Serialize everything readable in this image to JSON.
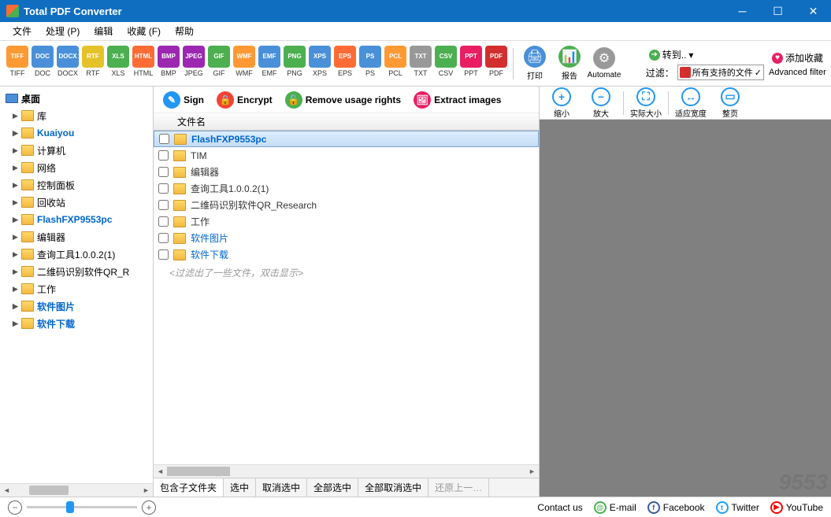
{
  "window": {
    "title": "Total PDF Converter"
  },
  "menu": [
    "文件",
    "处理 (P)",
    "编辑",
    "收藏 (F)",
    "帮助"
  ],
  "formats": [
    {
      "label": "TIFF",
      "color": "#ff9933"
    },
    {
      "label": "DOC",
      "color": "#4a90d9"
    },
    {
      "label": "DOCX",
      "color": "#4a90d9"
    },
    {
      "label": "RTF",
      "color": "#e6c229"
    },
    {
      "label": "XLS",
      "color": "#4caf50"
    },
    {
      "label": "HTML",
      "color": "#ff6b35"
    },
    {
      "label": "BMP",
      "color": "#9c27b0"
    },
    {
      "label": "JPEG",
      "color": "#9c27b0"
    },
    {
      "label": "GIF",
      "color": "#4caf50"
    },
    {
      "label": "WMF",
      "color": "#ff9933"
    },
    {
      "label": "EMF",
      "color": "#4a90d9"
    },
    {
      "label": "PNG",
      "color": "#4caf50"
    },
    {
      "label": "XPS",
      "color": "#4a90d9"
    },
    {
      "label": "EPS",
      "color": "#ff6b35"
    },
    {
      "label": "PS",
      "color": "#4a90d9"
    },
    {
      "label": "PCL",
      "color": "#ff9933"
    },
    {
      "label": "TXT",
      "color": "#999"
    },
    {
      "label": "CSV",
      "color": "#4caf50"
    },
    {
      "label": "PPT",
      "color": "#e91e63"
    },
    {
      "label": "PDF",
      "color": "#d32f2f"
    }
  ],
  "toolbar_big": [
    {
      "label": "打印",
      "icon": "🖨",
      "bg": "#4a90d9"
    },
    {
      "label": "报告",
      "icon": "📊",
      "bg": "#4caf50"
    },
    {
      "label": "Automate",
      "icon": "⚙",
      "bg": "#999"
    }
  ],
  "toolbar_links": {
    "goto": "转到..",
    "fav": "添加收藏"
  },
  "filter": {
    "label": "过滤：",
    "selected": "所有支持的文件",
    "adv": "Advanced filter"
  },
  "tree": {
    "root": "桌面",
    "items": [
      {
        "label": "库",
        "icon": "lib"
      },
      {
        "label": "Kuaiyou",
        "icon": "folder",
        "sel": true
      },
      {
        "label": "计算机",
        "icon": "pc"
      },
      {
        "label": "网络",
        "icon": "net"
      },
      {
        "label": "控制面板",
        "icon": "ctrl"
      },
      {
        "label": "回收站",
        "icon": "bin"
      },
      {
        "label": "FlashFXP9553pc",
        "icon": "folder",
        "sel": true
      },
      {
        "label": "编辑器",
        "icon": "folder"
      },
      {
        "label": "查询工具1.0.0.2(1)",
        "icon": "folder"
      },
      {
        "label": "二维码识别软件QR_R",
        "icon": "folder"
      },
      {
        "label": "工作",
        "icon": "folder"
      },
      {
        "label": "软件图片",
        "icon": "folder",
        "sel": true
      },
      {
        "label": "软件下载",
        "icon": "folder",
        "sel": true
      }
    ]
  },
  "actions": [
    {
      "label": "Sign",
      "bg": "#2196f3",
      "icon": "✎"
    },
    {
      "label": "Encrypt",
      "bg": "#f44336",
      "icon": "🔒"
    },
    {
      "label": "Remove usage rights",
      "bg": "#4caf50",
      "icon": "🔓"
    },
    {
      "label": "Extract images",
      "bg": "#e91e63",
      "icon": "🖼"
    }
  ],
  "file_header": "文件名",
  "files": [
    {
      "name": "FlashFXP9553pc",
      "sel": true
    },
    {
      "name": "TIM"
    },
    {
      "name": "编辑器"
    },
    {
      "name": "查询工具1.0.0.2(1)"
    },
    {
      "name": "二维码识别软件QR_Research"
    },
    {
      "name": "工作"
    },
    {
      "name": "软件图片",
      "link": true
    },
    {
      "name": "软件下载",
      "link": true
    }
  ],
  "filter_msg": "<过滤出了一些文件，双击显示>",
  "tabs": [
    "包含子文件夹",
    "选中",
    "取消选中",
    "全部选中",
    "全部取消选中",
    "还原上一…"
  ],
  "preview_btns": [
    {
      "label": "缩小",
      "icon": "+"
    },
    {
      "label": "放大",
      "icon": "−"
    },
    {
      "label": "实际大小",
      "icon": "⛶"
    },
    {
      "label": "适应宽度",
      "icon": "↔"
    },
    {
      "label": "整页",
      "icon": "▭"
    }
  ],
  "footer": {
    "contact": "Contact us",
    "email": "E-mail",
    "facebook": "Facebook",
    "twitter": "Twitter",
    "youtube": "YouTube"
  },
  "watermark": "9553"
}
